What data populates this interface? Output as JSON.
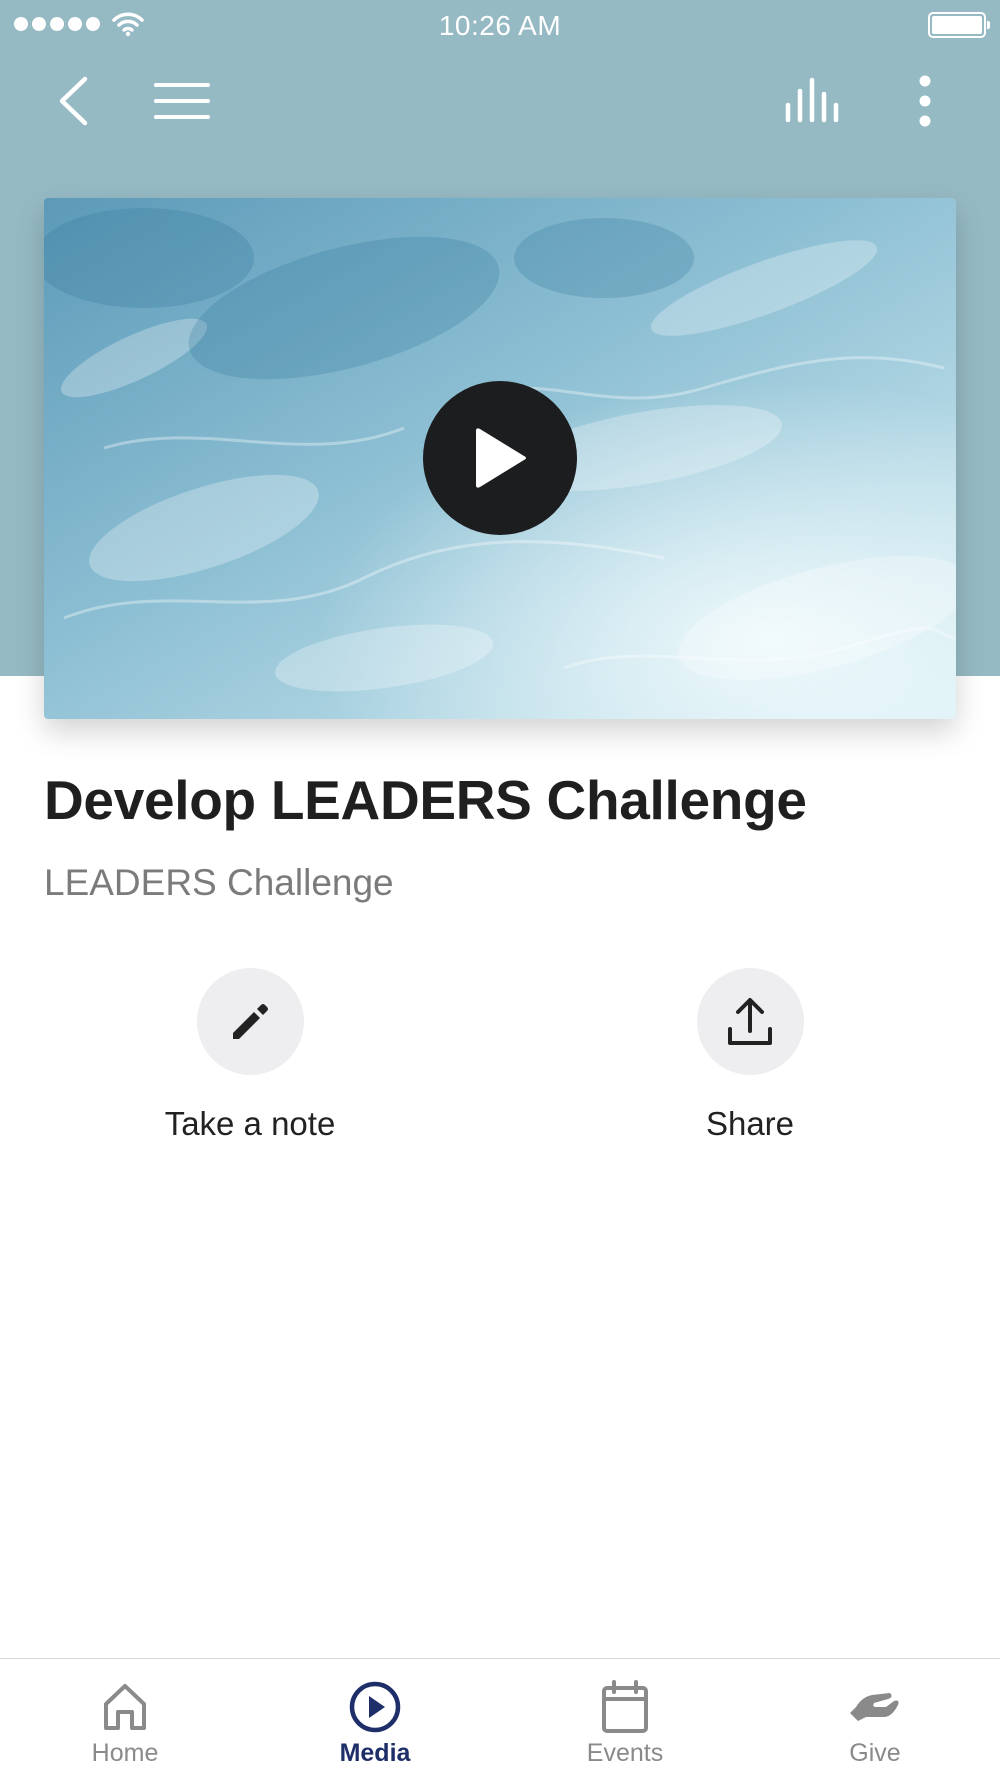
{
  "status_bar": {
    "time": "10:26 AM",
    "icons": [
      "signal-icon",
      "wifi-icon",
      "battery-icon"
    ]
  },
  "nav": {
    "icons": [
      "back-chevron-icon",
      "hamburger-menu-icon",
      "bar-stats-icon",
      "vertical-dots-icon"
    ]
  },
  "video": {
    "thumbnail": "water-surface",
    "play_icon": "play-icon"
  },
  "content": {
    "title": "Develop LEADERS Challenge",
    "subtitle": "LEADERS Challenge"
  },
  "actions": [
    {
      "label": "Take a note",
      "icon": "pencil-icon"
    },
    {
      "label": "Share",
      "icon": "upload-share-icon"
    }
  ],
  "tabbar": {
    "tabs": [
      {
        "label": "Home",
        "icon": "home-icon",
        "active": false
      },
      {
        "label": "Media",
        "icon": "play-circle-icon",
        "active": true
      },
      {
        "label": "Events",
        "icon": "calendar-icon",
        "active": false
      },
      {
        "label": "Give",
        "icon": "hand-give-icon",
        "active": false
      }
    ]
  },
  "colors": {
    "header_bg": "#96bac4",
    "active_tab": "#1e2e68",
    "inactive_tab": "#8a8a8a",
    "action_circle": "#eeeef0"
  }
}
